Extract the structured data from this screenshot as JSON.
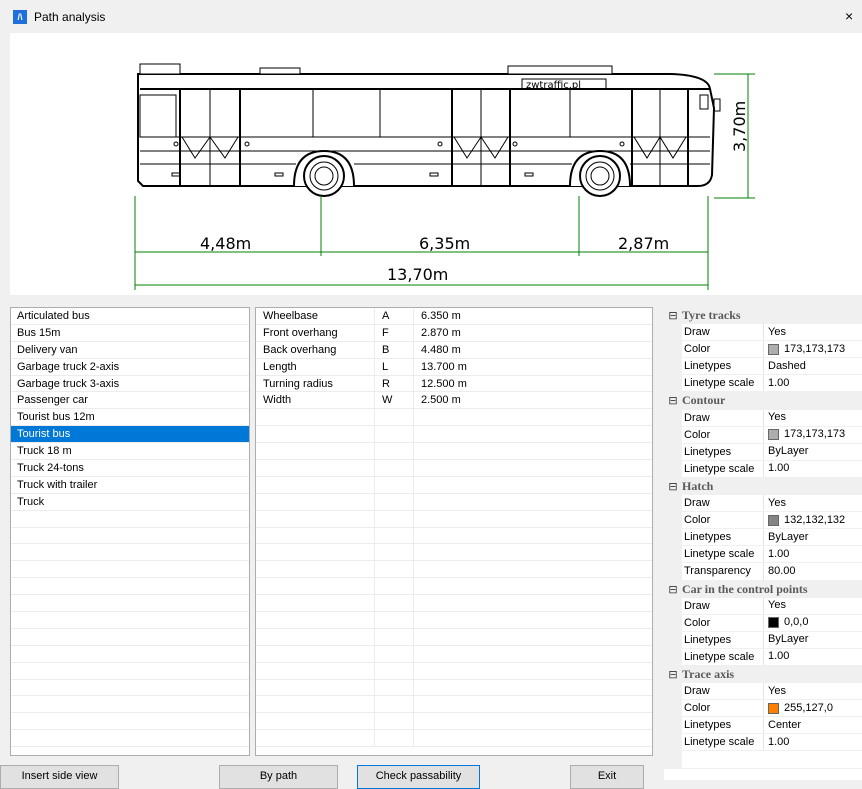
{
  "window": {
    "title": "Path analysis",
    "close_glyph": "×",
    "icon_glyph": "/\\"
  },
  "drawing": {
    "plate": "zwtraffic.pl",
    "dim_height": "3,70m",
    "dim_back": "4,48m",
    "dim_wheelbase": "6,35m",
    "dim_front": "2,87m",
    "dim_length": "13,70m"
  },
  "vehicles": {
    "items": [
      "Articulated bus",
      "Bus 15m",
      "Delivery van",
      "Garbage truck 2-axis",
      "Garbage truck 3-axis",
      "Passenger car",
      "Tourist bus 12m",
      "Tourist bus",
      "Truck 18 m",
      "Truck 24-tons",
      "Truck with trailer",
      "Truck"
    ],
    "selected_index": 7
  },
  "params": {
    "rows": [
      [
        "Wheelbase",
        "A",
        "6.350 m"
      ],
      [
        "Front overhang",
        "F",
        "2.870 m"
      ],
      [
        "Back overhang",
        "B",
        "4.480 m"
      ],
      [
        "Length",
        "L",
        "13.700 m"
      ],
      [
        "Turning radius",
        "R",
        "12.500 m"
      ],
      [
        "Width",
        "W",
        "2.500 m"
      ]
    ]
  },
  "properties": {
    "sections": [
      {
        "name": "Tyre tracks",
        "toggle": "⊟",
        "items": [
          {
            "k": "Draw",
            "v": "Yes"
          },
          {
            "k": "Color",
            "v": "173,173,173",
            "swatch": "#adadad"
          },
          {
            "k": "Linetypes",
            "v": "Dashed"
          },
          {
            "k": "Linetype scale",
            "v": "1.00"
          }
        ]
      },
      {
        "name": "Contour",
        "toggle": "⊟",
        "items": [
          {
            "k": "Draw",
            "v": "Yes"
          },
          {
            "k": "Color",
            "v": "173,173,173",
            "swatch": "#adadad"
          },
          {
            "k": "Linetypes",
            "v": "ByLayer"
          },
          {
            "k": "Linetype scale",
            "v": "1.00"
          }
        ]
      },
      {
        "name": "Hatch",
        "toggle": "⊟",
        "items": [
          {
            "k": "Draw",
            "v": "Yes"
          },
          {
            "k": "Color",
            "v": "132,132,132",
            "swatch": "#848484"
          },
          {
            "k": "Linetypes",
            "v": "ByLayer"
          },
          {
            "k": "Linetype scale",
            "v": "1.00"
          },
          {
            "k": "Transparency",
            "v": "80.00"
          }
        ]
      },
      {
        "name": "Car in the control points",
        "toggle": "⊟",
        "items": [
          {
            "k": "Draw",
            "v": "Yes"
          },
          {
            "k": "Color",
            "v": "0,0,0",
            "swatch": "#000000"
          },
          {
            "k": "Linetypes",
            "v": "ByLayer"
          },
          {
            "k": "Linetype scale",
            "v": "1.00"
          }
        ]
      },
      {
        "name": "Trace axis",
        "toggle": "⊟",
        "items": [
          {
            "k": "Draw",
            "v": "Yes"
          },
          {
            "k": "Color",
            "v": "255,127,0",
            "swatch": "#ff7f00"
          },
          {
            "k": "Linetypes",
            "v": "Center"
          },
          {
            "k": "Linetype scale",
            "v": "1.00"
          }
        ]
      }
    ]
  },
  "buttons": {
    "insert_side_view": "Insert side view",
    "by_path": "By path",
    "check_passability": "Check passability",
    "exit": "Exit"
  },
  "colors": {
    "selection": "#0078d7",
    "dimension": "#008000"
  }
}
